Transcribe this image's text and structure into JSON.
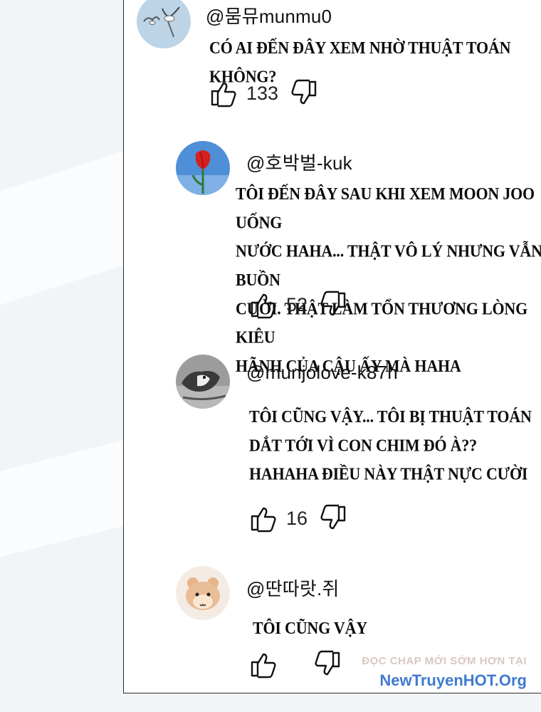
{
  "comments": [
    {
      "handle": "@뭄뮤munmu0",
      "text_lines": [
        "Có ai đến đây xem nhờ thuật toán không?"
      ],
      "likes": "133",
      "avatar": "seagulls-avatar"
    },
    {
      "handle": "@호박벌-kuk",
      "text_lines": [
        "Tôi đến đây sau khi xem Moon Joo uống",
        "nước haha... Thật vô lý nhưng vẫn buồn",
        "cười. Thật làm tổn thương lòng kiêu",
        "hãnh của cậu ấy mà haha"
      ],
      "likes": "52",
      "avatar": "tulip-avatar"
    },
    {
      "handle": "@munjolove-k87h",
      "text_lines": [
        "Tôi cũng vậy... Tôi bị thuật toán",
        "dắt tới vì con chim đó à??",
        "Hahaha điều này thật nực cười"
      ],
      "likes": "16",
      "avatar": "bird-avatar"
    },
    {
      "handle": "@딴따랏.쥐",
      "text_lines": [
        "Tôi cũng vậy"
      ],
      "likes": "",
      "avatar": "hamster-avatar"
    }
  ],
  "watermark": {
    "line1": "ĐỌC CHAP MỚI SỚM HƠN TẠI",
    "line2": "NewTruyenHOT.Org"
  },
  "colors": {
    "panel": "#ffffff",
    "page_bg": "#f2f5f8",
    "watermark_blue": "#3f7bd0"
  }
}
